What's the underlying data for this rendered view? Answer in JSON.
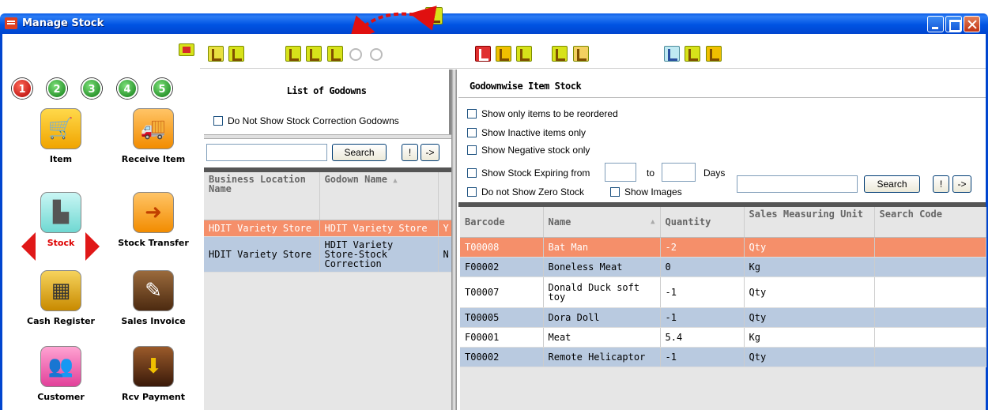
{
  "window": {
    "title": "Manage Stock",
    "controls": [
      "minimize",
      "maximize",
      "close"
    ]
  },
  "colors": {
    "titlebar": "#0054e3",
    "selected_row": "#f58f6a",
    "alt_row": "#b9cae0",
    "active_label": "#dd0000"
  },
  "steps": [
    "1",
    "2",
    "3",
    "4",
    "5"
  ],
  "nav": [
    {
      "label": "Item",
      "icon": "shopping-cart-icon"
    },
    {
      "label": "Receive Item",
      "icon": "delivery-truck-icon"
    },
    {
      "label": "Stock",
      "icon": "stock-trolley-icon",
      "active": true
    },
    {
      "label": "Stock Transfer",
      "icon": "stock-transfer-icon"
    },
    {
      "label": "Cash Register",
      "icon": "cash-register-icon"
    },
    {
      "label": "Sales Invoice",
      "icon": "sales-invoice-icon"
    },
    {
      "label": "Customer",
      "icon": "customer-icon"
    },
    {
      "label": "Rcv Payment",
      "icon": "receive-payment-icon"
    }
  ],
  "godowns": {
    "title": "List of Godowns",
    "hide_correction_label": "Do Not Show Stock Correction Godowns",
    "search_value": "",
    "search_label": "Search",
    "excl_label": "!",
    "arrow_label": "->",
    "columns": [
      "Business Location Name",
      "Godown Name"
    ],
    "rows": [
      {
        "location": "HDIT Variety Store",
        "godown": "HDIT Variety Store",
        "extra": "Y",
        "selected": true
      },
      {
        "location": "HDIT Variety Store",
        "godown": "HDIT Variety Store-Stock Correction",
        "extra": "N",
        "selected": false
      }
    ]
  },
  "item_stock": {
    "title": "Godownwise Item Stock",
    "filters": {
      "reorder": "Show only items to be reordered",
      "inactive": "Show Inactive items only",
      "negative": "Show Negative stock only",
      "expiring_from": "Show Stock Expiring from",
      "to": "to",
      "days": "Days",
      "zero_stock": "Do not Show Zero Stock",
      "images": "Show Images"
    },
    "search_value": "",
    "search_label": "Search",
    "excl_label": "!",
    "arrow_label": "->",
    "columns": [
      "Barcode",
      "Name",
      "Quantity",
      "Sales Measuring Unit",
      "Search Code"
    ],
    "rows": [
      {
        "barcode": "T00008",
        "name": "Bat Man",
        "quantity": "-2",
        "unit": "Qty",
        "search_code": "",
        "style": "sel"
      },
      {
        "barcode": "F00002",
        "name": "Boneless Meat",
        "quantity": "0",
        "unit": "Kg",
        "search_code": "",
        "style": "blue"
      },
      {
        "barcode": "T00007",
        "name": "Donald Duck soft toy",
        "quantity": "-1",
        "unit": "Qty",
        "search_code": "",
        "style": "white"
      },
      {
        "barcode": "T00005",
        "name": "Dora Doll",
        "quantity": "-1",
        "unit": "Qty",
        "search_code": "",
        "style": "blue"
      },
      {
        "barcode": "F00001",
        "name": "Meat",
        "quantity": "5.4",
        "unit": "Kg",
        "search_code": "",
        "style": "white"
      },
      {
        "barcode": "T00002",
        "name": "Remote Helicaptor",
        "quantity": "-1",
        "unit": "Qty",
        "search_code": "",
        "style": "blue"
      }
    ]
  }
}
